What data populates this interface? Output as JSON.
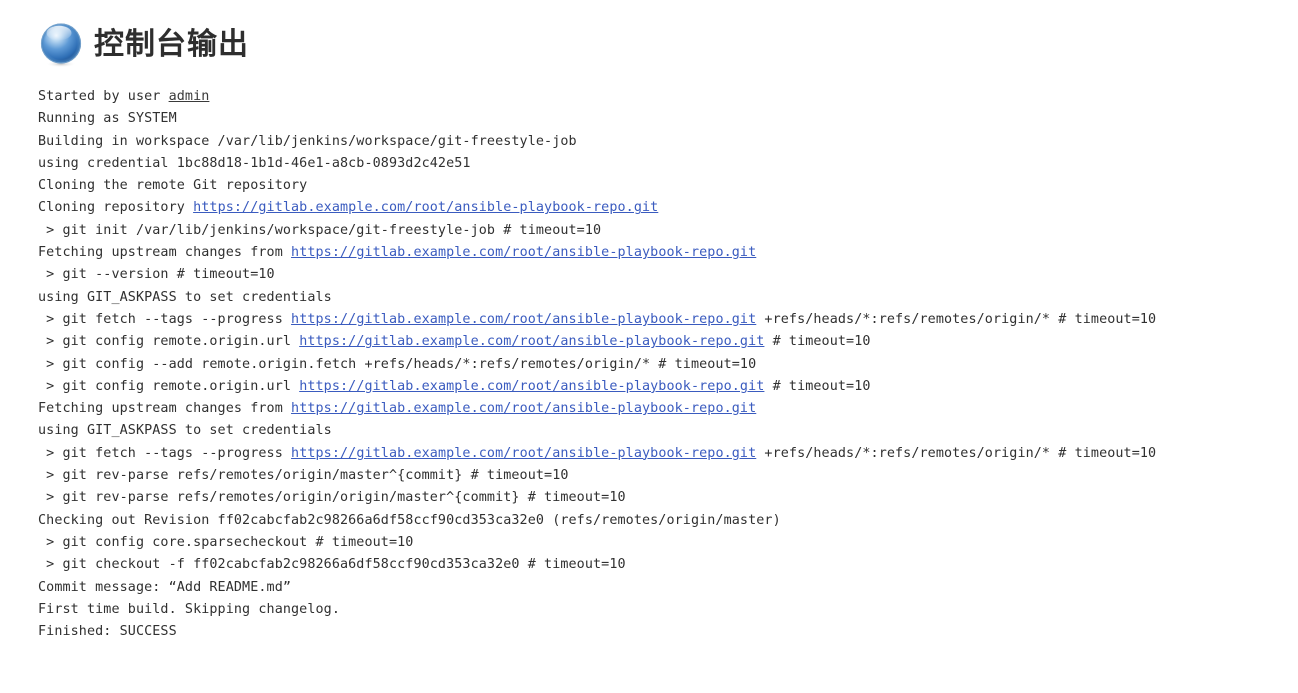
{
  "header": {
    "title": "控制台输出",
    "icon": "blue-sphere-icon",
    "icon_color": "#2a6bbf"
  },
  "colors": {
    "link_url": "#3a5bbf",
    "link_user": "#3a3a3a",
    "text": "#303030",
    "background": "#ffffff"
  },
  "console": {
    "repo_url": "https://gitlab.example.com/root/ansible-playbook-repo.git",
    "user_link": "admin",
    "workspace": "/var/lib/jenkins/workspace/git-freestyle-job",
    "credential_id": "1bc88d18-1b1d-46e1-a8cb-0893d2c42e51",
    "revision": "ff02cabcfab2c98266a6df58ccf90cd353ca32e0",
    "commit_message": "“Add README.md”",
    "result": "SUCCESS",
    "lines": [
      {
        "parts": [
          {
            "t": "Started by user "
          },
          {
            "t": "admin",
            "link": "user"
          }
        ]
      },
      {
        "parts": [
          {
            "t": "Running as SYSTEM"
          }
        ]
      },
      {
        "parts": [
          {
            "t": "Building in workspace /var/lib/jenkins/workspace/git-freestyle-job"
          }
        ]
      },
      {
        "parts": [
          {
            "t": "using credential 1bc88d18-1b1d-46e1-a8cb-0893d2c42e51"
          }
        ]
      },
      {
        "parts": [
          {
            "t": "Cloning the remote Git repository"
          }
        ]
      },
      {
        "parts": [
          {
            "t": "Cloning repository "
          },
          {
            "t": "https://gitlab.example.com/root/ansible-playbook-repo.git",
            "link": "url"
          }
        ]
      },
      {
        "parts": [
          {
            "t": " > git init /var/lib/jenkins/workspace/git-freestyle-job # timeout=10"
          }
        ]
      },
      {
        "parts": [
          {
            "t": "Fetching upstream changes from "
          },
          {
            "t": "https://gitlab.example.com/root/ansible-playbook-repo.git",
            "link": "url"
          }
        ]
      },
      {
        "parts": [
          {
            "t": " > git --version # timeout=10"
          }
        ]
      },
      {
        "parts": [
          {
            "t": "using GIT_ASKPASS to set credentials"
          }
        ]
      },
      {
        "parts": [
          {
            "t": " > git fetch --tags --progress "
          },
          {
            "t": "https://gitlab.example.com/root/ansible-playbook-repo.git",
            "link": "url"
          },
          {
            "t": " +refs/heads/*:refs/remotes/origin/* # timeout=10"
          }
        ]
      },
      {
        "parts": [
          {
            "t": " > git config remote.origin.url "
          },
          {
            "t": "https://gitlab.example.com/root/ansible-playbook-repo.git",
            "link": "url"
          },
          {
            "t": " # timeout=10"
          }
        ]
      },
      {
        "parts": [
          {
            "t": " > git config --add remote.origin.fetch +refs/heads/*:refs/remotes/origin/* # timeout=10"
          }
        ]
      },
      {
        "parts": [
          {
            "t": " > git config remote.origin.url "
          },
          {
            "t": "https://gitlab.example.com/root/ansible-playbook-repo.git",
            "link": "url"
          },
          {
            "t": " # timeout=10"
          }
        ]
      },
      {
        "parts": [
          {
            "t": "Fetching upstream changes from "
          },
          {
            "t": "https://gitlab.example.com/root/ansible-playbook-repo.git",
            "link": "url"
          }
        ]
      },
      {
        "parts": [
          {
            "t": "using GIT_ASKPASS to set credentials"
          }
        ]
      },
      {
        "parts": [
          {
            "t": " > git fetch --tags --progress "
          },
          {
            "t": "https://gitlab.example.com/root/ansible-playbook-repo.git",
            "link": "url"
          },
          {
            "t": " +refs/heads/*:refs/remotes/origin/* # timeout=10"
          }
        ]
      },
      {
        "parts": [
          {
            "t": " > git rev-parse refs/remotes/origin/master^{commit} # timeout=10"
          }
        ]
      },
      {
        "parts": [
          {
            "t": " > git rev-parse refs/remotes/origin/origin/master^{commit} # timeout=10"
          }
        ]
      },
      {
        "parts": [
          {
            "t": "Checking out Revision ff02cabcfab2c98266a6df58ccf90cd353ca32e0 (refs/remotes/origin/master)"
          }
        ]
      },
      {
        "parts": [
          {
            "t": " > git config core.sparsecheckout # timeout=10"
          }
        ]
      },
      {
        "parts": [
          {
            "t": " > git checkout -f ff02cabcfab2c98266a6df58ccf90cd353ca32e0 # timeout=10"
          }
        ]
      },
      {
        "parts": [
          {
            "t": "Commit message: “Add README.md”"
          }
        ]
      },
      {
        "parts": [
          {
            "t": "First time build. Skipping changelog."
          }
        ]
      },
      {
        "parts": [
          {
            "t": "Finished: SUCCESS"
          }
        ]
      }
    ]
  }
}
